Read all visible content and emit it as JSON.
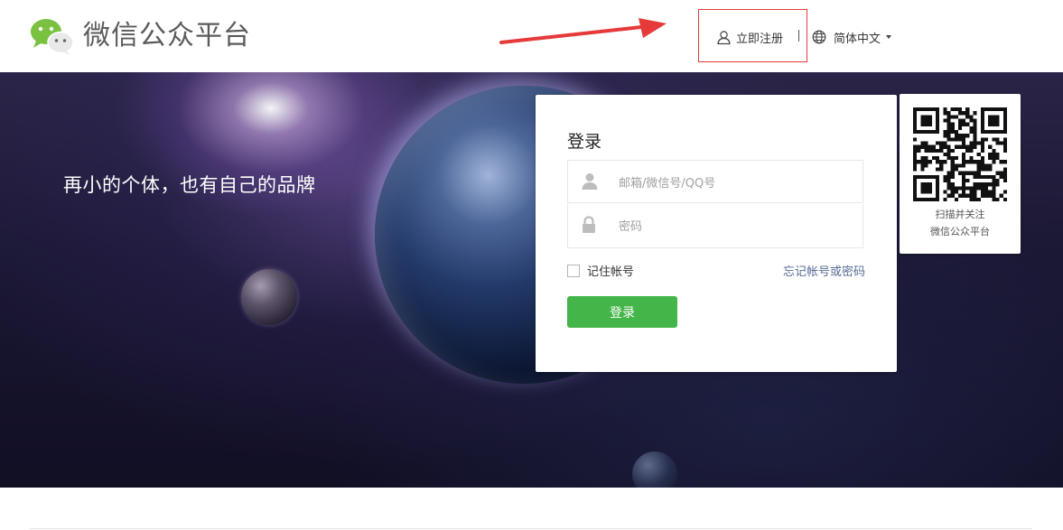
{
  "header": {
    "brand_name": "微信公众平台",
    "register_label": "立即注册",
    "language_label": "简体中文",
    "separator": "|"
  },
  "banner": {
    "slogan": "再小的个体，也有自己的品牌"
  },
  "login": {
    "title": "登录",
    "account_placeholder": "邮箱/微信号/QQ号",
    "account_value": "",
    "password_placeholder": "密码",
    "password_value": "",
    "remember_label": "记住帐号",
    "remember_checked": false,
    "forgot_label": "忘记帐号或密码",
    "submit_label": "登录"
  },
  "qr": {
    "caption_line1": "扫描并关注",
    "caption_line2": "微信公众平台"
  },
  "colors": {
    "accent_green": "#44b549",
    "link_blue": "#576b95",
    "highlight_red": "#e63a3a",
    "wechat_green": "#7ac142"
  },
  "icons": [
    "wechat-logo-icon",
    "user-icon",
    "globe-icon",
    "chevron-down-icon",
    "lock-icon",
    "qr-code",
    "red-arrow-annotation"
  ]
}
